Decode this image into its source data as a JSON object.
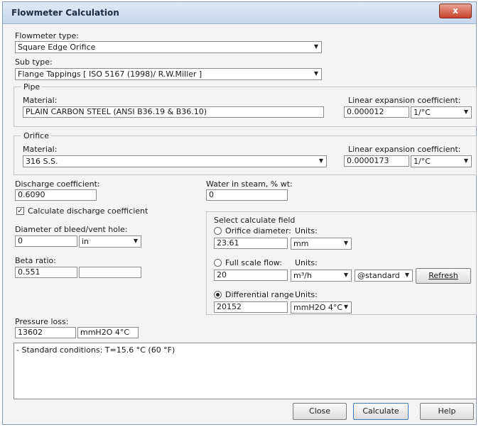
{
  "window": {
    "title": "Flowmeter Calculation",
    "close_glyph": "x"
  },
  "flowmeter_type": {
    "label": "Flowmeter type:",
    "value": "Square Edge Orifice"
  },
  "sub_type": {
    "label": "Sub type:",
    "value": "Flange Tappings [ ISO 5167 (1998)/ R.W.Miller ]"
  },
  "pipe": {
    "group_title": "Pipe",
    "material_label": "Material:",
    "material_value": "PLAIN CARBON STEEL (ANSI B36.19 & B36.10)",
    "lin_exp_label": "Linear expansion coefficient:",
    "lin_exp_value": "0.000012",
    "lin_exp_unit": "1/°C"
  },
  "orifice": {
    "group_title": "Orifice",
    "material_label": "Material:",
    "material_value": "316 S.S.",
    "lin_exp_label": "Linear expansion coefficient:",
    "lin_exp_value": "0.0000173",
    "lin_exp_unit": "1/°C"
  },
  "discharge": {
    "label": "Discharge coefficient:",
    "value": "0.6090"
  },
  "water_in_steam": {
    "label": "Water in steam, % wt:",
    "value": "0"
  },
  "calc_discharge": {
    "label": "Calculate discharge coefficient",
    "checked_glyph": "✓"
  },
  "bleed_hole": {
    "label": "Diameter of bleed/vent hole:",
    "value": "0",
    "unit": "in"
  },
  "beta": {
    "label": "Beta ratio:",
    "value": "0.551",
    "extra": ""
  },
  "select_field": {
    "group_title": "Select calculate field",
    "orifice_diameter": {
      "label": "Orifice diameter:",
      "units_label": "Units:",
      "value": "23.61",
      "unit": "mm"
    },
    "full_scale": {
      "label": "Full scale flow:",
      "units_label": "Units:",
      "value": "20",
      "unit": "m³/h",
      "condition": "@standard",
      "refresh_label": "Refresh"
    },
    "differential": {
      "label": "Differential range",
      "units_label": "Units:",
      "value": "20152",
      "unit": "mmH2O 4°C"
    }
  },
  "pressure_loss": {
    "label": "Pressure loss:",
    "value": "13602",
    "unit": "mmH2O 4°C"
  },
  "memo": {
    "text": "- Standard conditions: T=15.6 °C (60 °F)"
  },
  "buttons": {
    "close": "Close",
    "calculate": "Calculate",
    "help": "Help"
  }
}
